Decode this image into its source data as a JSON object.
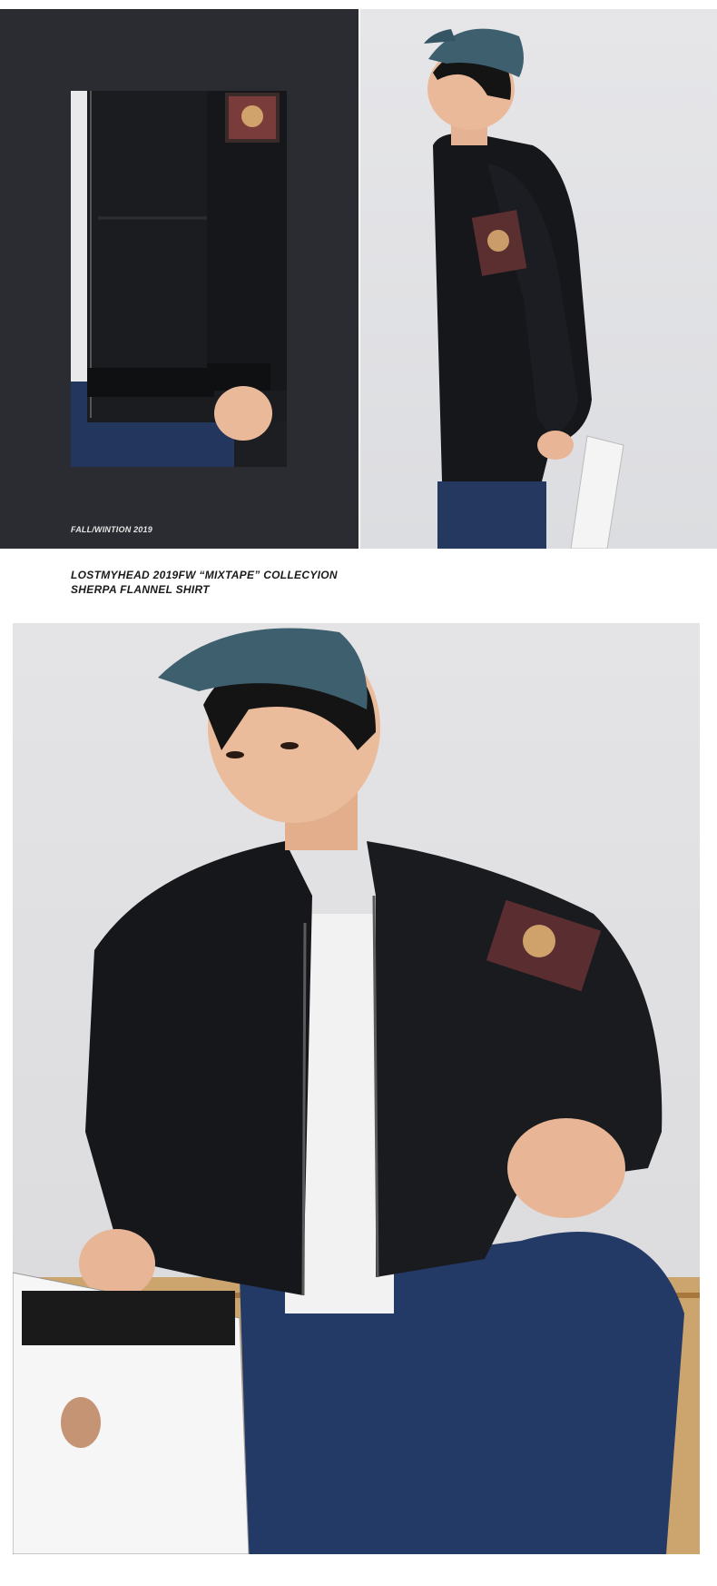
{
  "panel_caption": "FALL/WINTION 2019",
  "title": {
    "line1": "LOSTMYHEAD 2019FW “MIXTAPE” COLLECYION",
    "line2": "SHERPA FLANNEL SHIRT"
  },
  "colors": {
    "dark_panel": "#2b2c31",
    "jacket": "#141518",
    "cap": "#3d5f6e",
    "jeans": "#2a3d63",
    "background": "#ffffff"
  }
}
